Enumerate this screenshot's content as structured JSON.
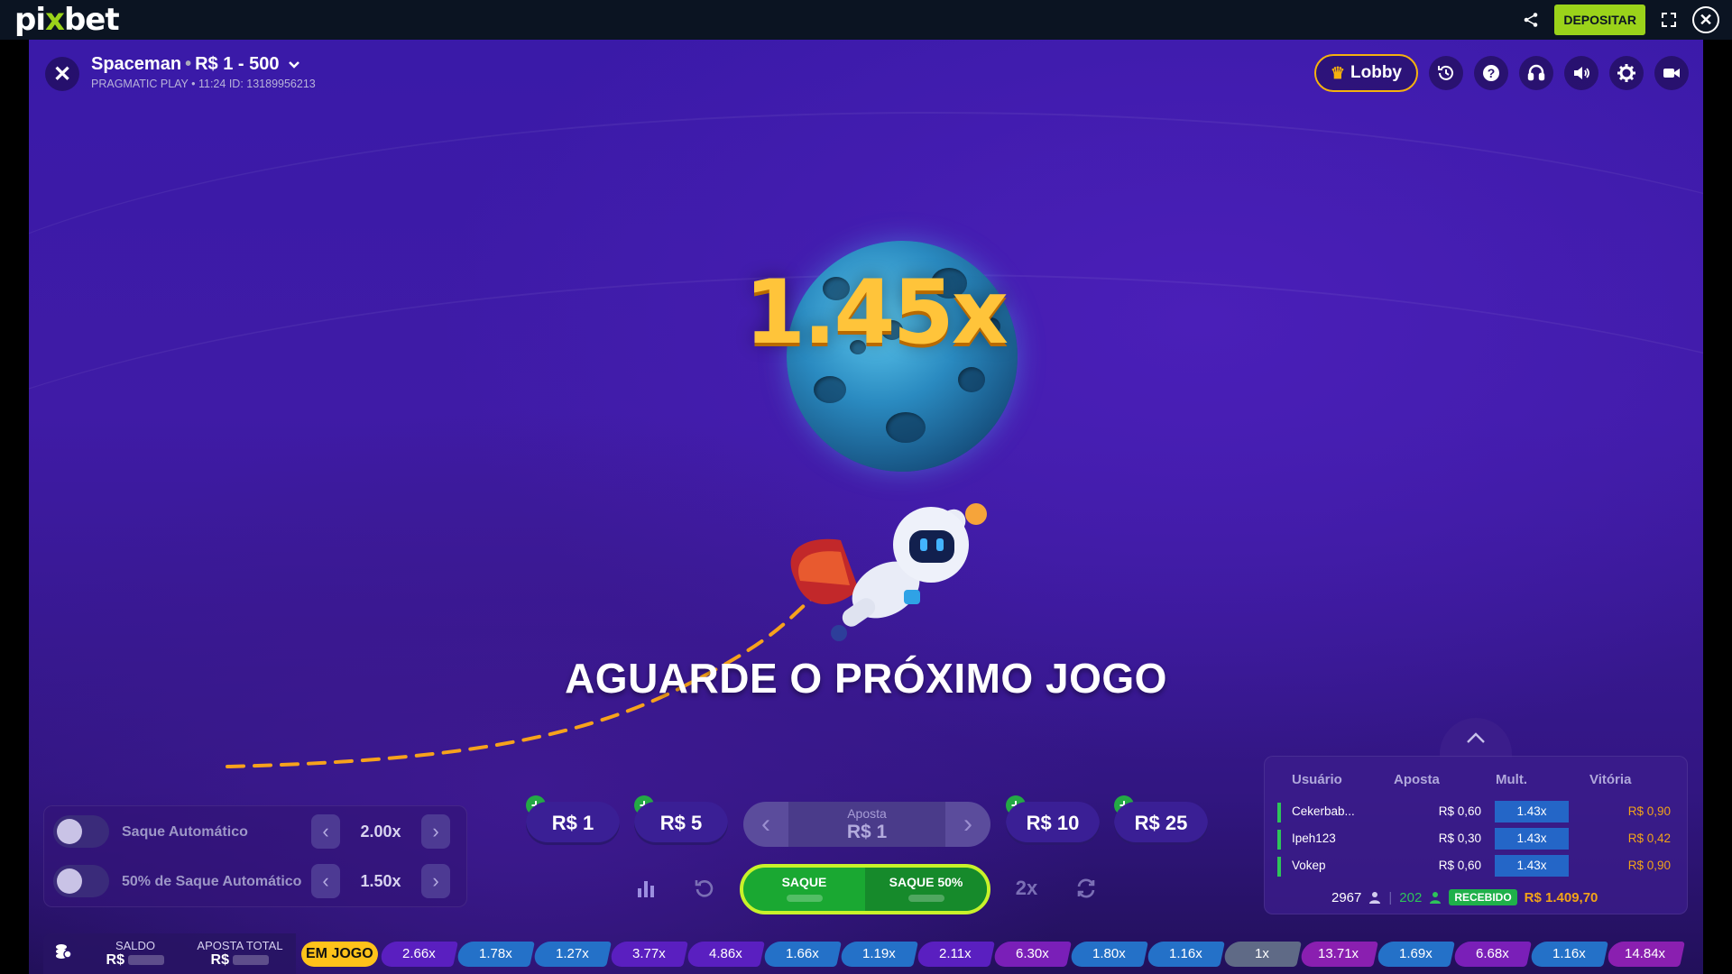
{
  "site": {
    "logo_prefix": "pi",
    "logo_x": "x",
    "logo_suffix": "bet",
    "deposit_label": "DEPOSITAR",
    "icons": [
      "share-icon",
      "expand-icon",
      "close-circle-icon"
    ],
    "accent_color": "#9bd31a"
  },
  "game": {
    "title": "Spaceman",
    "limits": "R$ 1 - 500",
    "subtitle": "PRAGMATIC PLAY • 11:24 ID: 13189956213",
    "lobby_label": "Lobby",
    "header_icons": [
      "history-icon",
      "help-icon",
      "support-icon",
      "sound-icon",
      "settings-icon",
      "video-icon"
    ]
  },
  "round": {
    "multiplier": "1.45x",
    "message": "AGUARDE O PRÓXIMO JOGO"
  },
  "auto": {
    "auto_cashout_label": "Saque Automático",
    "auto_cashout_value": "2.00x",
    "half_cashout_label": "50% de Saque Automático",
    "half_cashout_value": "1.50x"
  },
  "bet": {
    "chips": [
      "R$ 1",
      "R$ 5",
      "R$ 10",
      "R$ 25"
    ],
    "aposta_label": "Aposta",
    "aposta_value": "R$ 1",
    "cashout_label": "SAQUE",
    "cashout_half_label": "SAQUE 50%",
    "double_label": "2x"
  },
  "bets_panel": {
    "headers": {
      "user": "Usuário",
      "bet": "Aposta",
      "mult": "Mult.",
      "win": "Vitória"
    },
    "rows": [
      {
        "user": "Cekerbab...",
        "bet": "R$ 0,60",
        "mult": "1.43x",
        "win": "R$ 0,90"
      },
      {
        "user": "Ipeh123",
        "bet": "R$ 0,30",
        "mult": "1.43x",
        "win": "R$ 0,42"
      },
      {
        "user": "Vokep",
        "bet": "R$ 0,60",
        "mult": "1.43x",
        "win": "R$ 0,90"
      }
    ],
    "players": "2967",
    "winners": "202",
    "received_label": "RECEBIDO",
    "received_total": "R$ 1.409,70"
  },
  "bottom": {
    "balance_label": "SALDO",
    "balance_currency": "R$",
    "total_bet_label": "APOSTA TOTAL",
    "total_bet_currency": "R$",
    "in_game_label": "EM JOGO",
    "history": [
      {
        "v": "2.66x",
        "c": "#5a1fc0"
      },
      {
        "v": "1.78x",
        "c": "#2471c8"
      },
      {
        "v": "1.27x",
        "c": "#2471c8"
      },
      {
        "v": "3.77x",
        "c": "#5a1fc0"
      },
      {
        "v": "4.86x",
        "c": "#5a1fc0"
      },
      {
        "v": "1.66x",
        "c": "#2471c8"
      },
      {
        "v": "1.19x",
        "c": "#2471c8"
      },
      {
        "v": "2.11x",
        "c": "#5a1fc0"
      },
      {
        "v": "6.30x",
        "c": "#7a1fb8"
      },
      {
        "v": "1.80x",
        "c": "#2471c8"
      },
      {
        "v": "1.16x",
        "c": "#2471c8"
      },
      {
        "v": "1x",
        "c": "#5f6a86"
      },
      {
        "v": "13.71x",
        "c": "#8a1fb0"
      },
      {
        "v": "1.69x",
        "c": "#2471c8"
      },
      {
        "v": "6.68x",
        "c": "#7a1fb8"
      },
      {
        "v": "1.16x",
        "c": "#2471c8"
      },
      {
        "v": "14.84x",
        "c": "#8a1fb0"
      }
    ]
  }
}
